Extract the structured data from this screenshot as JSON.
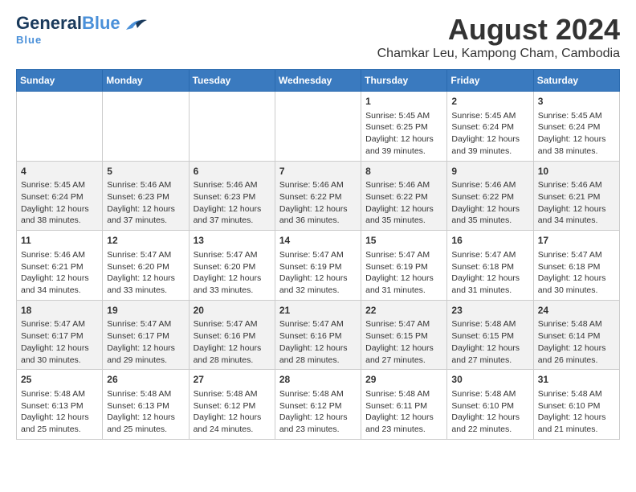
{
  "logo": {
    "line1a": "General",
    "line1b": "Blue",
    "line2": "Blue"
  },
  "title": "August 2024",
  "subtitle": "Chamkar Leu, Kampong Cham, Cambodia",
  "days_of_week": [
    "Sunday",
    "Monday",
    "Tuesday",
    "Wednesday",
    "Thursday",
    "Friday",
    "Saturday"
  ],
  "weeks": [
    [
      {
        "day": "",
        "info": ""
      },
      {
        "day": "",
        "info": ""
      },
      {
        "day": "",
        "info": ""
      },
      {
        "day": "",
        "info": ""
      },
      {
        "day": "1",
        "info": "Sunrise: 5:45 AM\nSunset: 6:25 PM\nDaylight: 12 hours\nand 39 minutes."
      },
      {
        "day": "2",
        "info": "Sunrise: 5:45 AM\nSunset: 6:24 PM\nDaylight: 12 hours\nand 39 minutes."
      },
      {
        "day": "3",
        "info": "Sunrise: 5:45 AM\nSunset: 6:24 PM\nDaylight: 12 hours\nand 38 minutes."
      }
    ],
    [
      {
        "day": "4",
        "info": "Sunrise: 5:45 AM\nSunset: 6:24 PM\nDaylight: 12 hours\nand 38 minutes."
      },
      {
        "day": "5",
        "info": "Sunrise: 5:46 AM\nSunset: 6:23 PM\nDaylight: 12 hours\nand 37 minutes."
      },
      {
        "day": "6",
        "info": "Sunrise: 5:46 AM\nSunset: 6:23 PM\nDaylight: 12 hours\nand 37 minutes."
      },
      {
        "day": "7",
        "info": "Sunrise: 5:46 AM\nSunset: 6:22 PM\nDaylight: 12 hours\nand 36 minutes."
      },
      {
        "day": "8",
        "info": "Sunrise: 5:46 AM\nSunset: 6:22 PM\nDaylight: 12 hours\nand 35 minutes."
      },
      {
        "day": "9",
        "info": "Sunrise: 5:46 AM\nSunset: 6:22 PM\nDaylight: 12 hours\nand 35 minutes."
      },
      {
        "day": "10",
        "info": "Sunrise: 5:46 AM\nSunset: 6:21 PM\nDaylight: 12 hours\nand 34 minutes."
      }
    ],
    [
      {
        "day": "11",
        "info": "Sunrise: 5:46 AM\nSunset: 6:21 PM\nDaylight: 12 hours\nand 34 minutes."
      },
      {
        "day": "12",
        "info": "Sunrise: 5:47 AM\nSunset: 6:20 PM\nDaylight: 12 hours\nand 33 minutes."
      },
      {
        "day": "13",
        "info": "Sunrise: 5:47 AM\nSunset: 6:20 PM\nDaylight: 12 hours\nand 33 minutes."
      },
      {
        "day": "14",
        "info": "Sunrise: 5:47 AM\nSunset: 6:19 PM\nDaylight: 12 hours\nand 32 minutes."
      },
      {
        "day": "15",
        "info": "Sunrise: 5:47 AM\nSunset: 6:19 PM\nDaylight: 12 hours\nand 31 minutes."
      },
      {
        "day": "16",
        "info": "Sunrise: 5:47 AM\nSunset: 6:18 PM\nDaylight: 12 hours\nand 31 minutes."
      },
      {
        "day": "17",
        "info": "Sunrise: 5:47 AM\nSunset: 6:18 PM\nDaylight: 12 hours\nand 30 minutes."
      }
    ],
    [
      {
        "day": "18",
        "info": "Sunrise: 5:47 AM\nSunset: 6:17 PM\nDaylight: 12 hours\nand 30 minutes."
      },
      {
        "day": "19",
        "info": "Sunrise: 5:47 AM\nSunset: 6:17 PM\nDaylight: 12 hours\nand 29 minutes."
      },
      {
        "day": "20",
        "info": "Sunrise: 5:47 AM\nSunset: 6:16 PM\nDaylight: 12 hours\nand 28 minutes."
      },
      {
        "day": "21",
        "info": "Sunrise: 5:47 AM\nSunset: 6:16 PM\nDaylight: 12 hours\nand 28 minutes."
      },
      {
        "day": "22",
        "info": "Sunrise: 5:47 AM\nSunset: 6:15 PM\nDaylight: 12 hours\nand 27 minutes."
      },
      {
        "day": "23",
        "info": "Sunrise: 5:48 AM\nSunset: 6:15 PM\nDaylight: 12 hours\nand 27 minutes."
      },
      {
        "day": "24",
        "info": "Sunrise: 5:48 AM\nSunset: 6:14 PM\nDaylight: 12 hours\nand 26 minutes."
      }
    ],
    [
      {
        "day": "25",
        "info": "Sunrise: 5:48 AM\nSunset: 6:13 PM\nDaylight: 12 hours\nand 25 minutes."
      },
      {
        "day": "26",
        "info": "Sunrise: 5:48 AM\nSunset: 6:13 PM\nDaylight: 12 hours\nand 25 minutes."
      },
      {
        "day": "27",
        "info": "Sunrise: 5:48 AM\nSunset: 6:12 PM\nDaylight: 12 hours\nand 24 minutes."
      },
      {
        "day": "28",
        "info": "Sunrise: 5:48 AM\nSunset: 6:12 PM\nDaylight: 12 hours\nand 23 minutes."
      },
      {
        "day": "29",
        "info": "Sunrise: 5:48 AM\nSunset: 6:11 PM\nDaylight: 12 hours\nand 23 minutes."
      },
      {
        "day": "30",
        "info": "Sunrise: 5:48 AM\nSunset: 6:10 PM\nDaylight: 12 hours\nand 22 minutes."
      },
      {
        "day": "31",
        "info": "Sunrise: 5:48 AM\nSunset: 6:10 PM\nDaylight: 12 hours\nand 21 minutes."
      }
    ]
  ]
}
